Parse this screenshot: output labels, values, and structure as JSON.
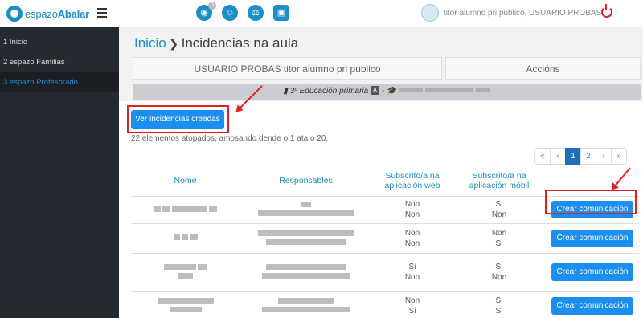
{
  "app": {
    "logo_text_light": "espazo",
    "logo_text_bold": "Abalar",
    "notification_count": "0",
    "user_name": "titor alumno pri publico, USUARIO PROBAS"
  },
  "sidebar": {
    "items": [
      {
        "label": "1 Inicio"
      },
      {
        "label": "2 espazo Familias"
      },
      {
        "label": "3 espazo Profesorado"
      }
    ]
  },
  "breadcrumb": {
    "home": "Inicio",
    "current": "Incidencias na aula"
  },
  "tabs": {
    "user": "USUARIO PROBAS titor alumno pri publico",
    "actions": "Accións"
  },
  "course": {
    "label": "3º Educación primaria",
    "group_badge": "A",
    "dash": "-"
  },
  "buttons": {
    "ver_incidencias": "Ver incidencias creadas",
    "crear": "Crear comunicación"
  },
  "info_text": "22 elementos atopados, amosando dende o 1 ata o 20.",
  "pagination": [
    "«",
    "‹",
    "1",
    "2",
    "›",
    "»"
  ],
  "table": {
    "headers": {
      "nome": "Nome",
      "responsables": "Responsables",
      "web": "Subscrito/a na aplicación web",
      "mobil": "Subscrito/a na aplicación móbil"
    },
    "rows": [
      {
        "web": [
          "Non",
          "Non"
        ],
        "mobil": [
          "Si",
          "Non"
        ]
      },
      {
        "web": [
          "Non",
          "Non"
        ],
        "mobil": [
          "Non",
          "Si"
        ]
      },
      {
        "web": [
          "Si",
          "Non"
        ],
        "mobil": [
          "Si",
          "Non"
        ]
      },
      {
        "web": [
          "Non",
          "Si"
        ],
        "mobil": [
          "Si",
          "Si"
        ]
      }
    ]
  },
  "colors": {
    "accent": "#1c8ec9",
    "button": "#1c8ef0",
    "highlight": "#e02020",
    "sidebar": "#242a30"
  }
}
